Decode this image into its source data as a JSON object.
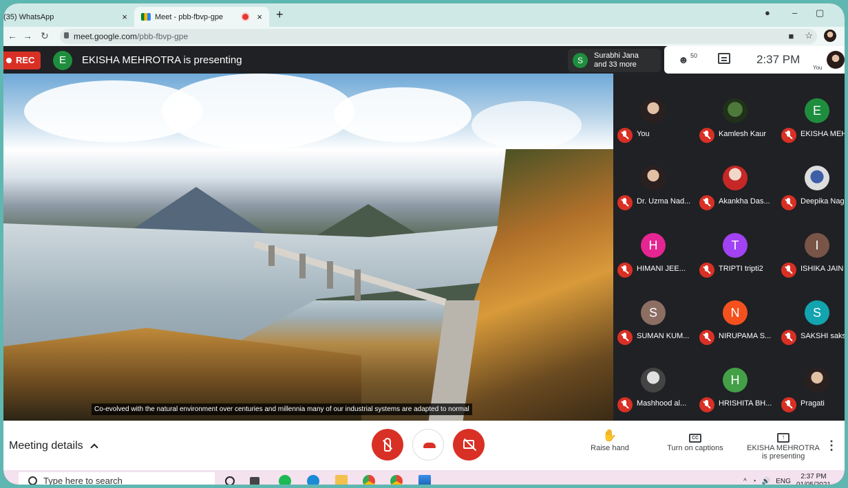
{
  "browser": {
    "tabs": [
      {
        "label": "(35) WhatsApp"
      },
      {
        "label": "Meet - pbb-fbvp-gpe"
      }
    ],
    "new_tab": "+",
    "url_host": "meet.google.com",
    "url_path": "/pbb-fbvp-gpe"
  },
  "meet_top": {
    "rec_label": "REC",
    "presenter_initial": "E",
    "presenting_text": "EKISHA MEHROTRA is presenting",
    "joined_initial": "S",
    "joined_line1": "Surabhi Jana",
    "joined_line2": "and 33 more",
    "people_count": "50",
    "time": "2:37 PM",
    "you_label": "You"
  },
  "presentation": {
    "caption": "Co-evolved with the natural environment over centuries and millennia many of our industrial systems are adapted to normal"
  },
  "participants": [
    {
      "name": "You",
      "initial": "",
      "color": "photo"
    },
    {
      "name": "Kamlesh Kaur",
      "initial": "",
      "color": "photo green"
    },
    {
      "name": "EKISHA MEH...",
      "initial": "E",
      "color": "#1e8e3e"
    },
    {
      "name": "Dr. Uzma Nad...",
      "initial": "",
      "color": "photo"
    },
    {
      "name": "Akankha Das...",
      "initial": "",
      "color": "photo red"
    },
    {
      "name": "Deepika Naga",
      "initial": "",
      "color": "photo blue"
    },
    {
      "name": "HIMANI JEE...",
      "initial": "H",
      "color": "#e52592"
    },
    {
      "name": "TRIPTI tripti2",
      "initial": "T",
      "color": "#a142f4"
    },
    {
      "name": "ISHIKA JAIN",
      "initial": "I",
      "color": "#795548"
    },
    {
      "name": "SUMAN KUM...",
      "initial": "S",
      "color": "#8d6e63"
    },
    {
      "name": "NIRUPAMA S...",
      "initial": "N",
      "color": "#f4511e"
    },
    {
      "name": "SAKSHI saks...",
      "initial": "S",
      "color": "#12a4af"
    },
    {
      "name": "Mashhood al...",
      "initial": "",
      "color": "photo grey"
    },
    {
      "name": "HRISHITA BH...",
      "initial": "H",
      "color": "#43a047"
    },
    {
      "name": "Pragati",
      "initial": "",
      "color": "photo"
    }
  ],
  "controls": {
    "meeting_details": "Meeting details",
    "raise_hand": "Raise hand",
    "captions": "Turn on captions",
    "cc": "CC",
    "presenting_line1": "EKISHA MEHROTRA",
    "presenting_line2": "is presenting"
  },
  "taskbar": {
    "search_placeholder": "Type here to search",
    "lang": "ENG",
    "time": "2:37 PM",
    "date": "01/05/2021"
  }
}
